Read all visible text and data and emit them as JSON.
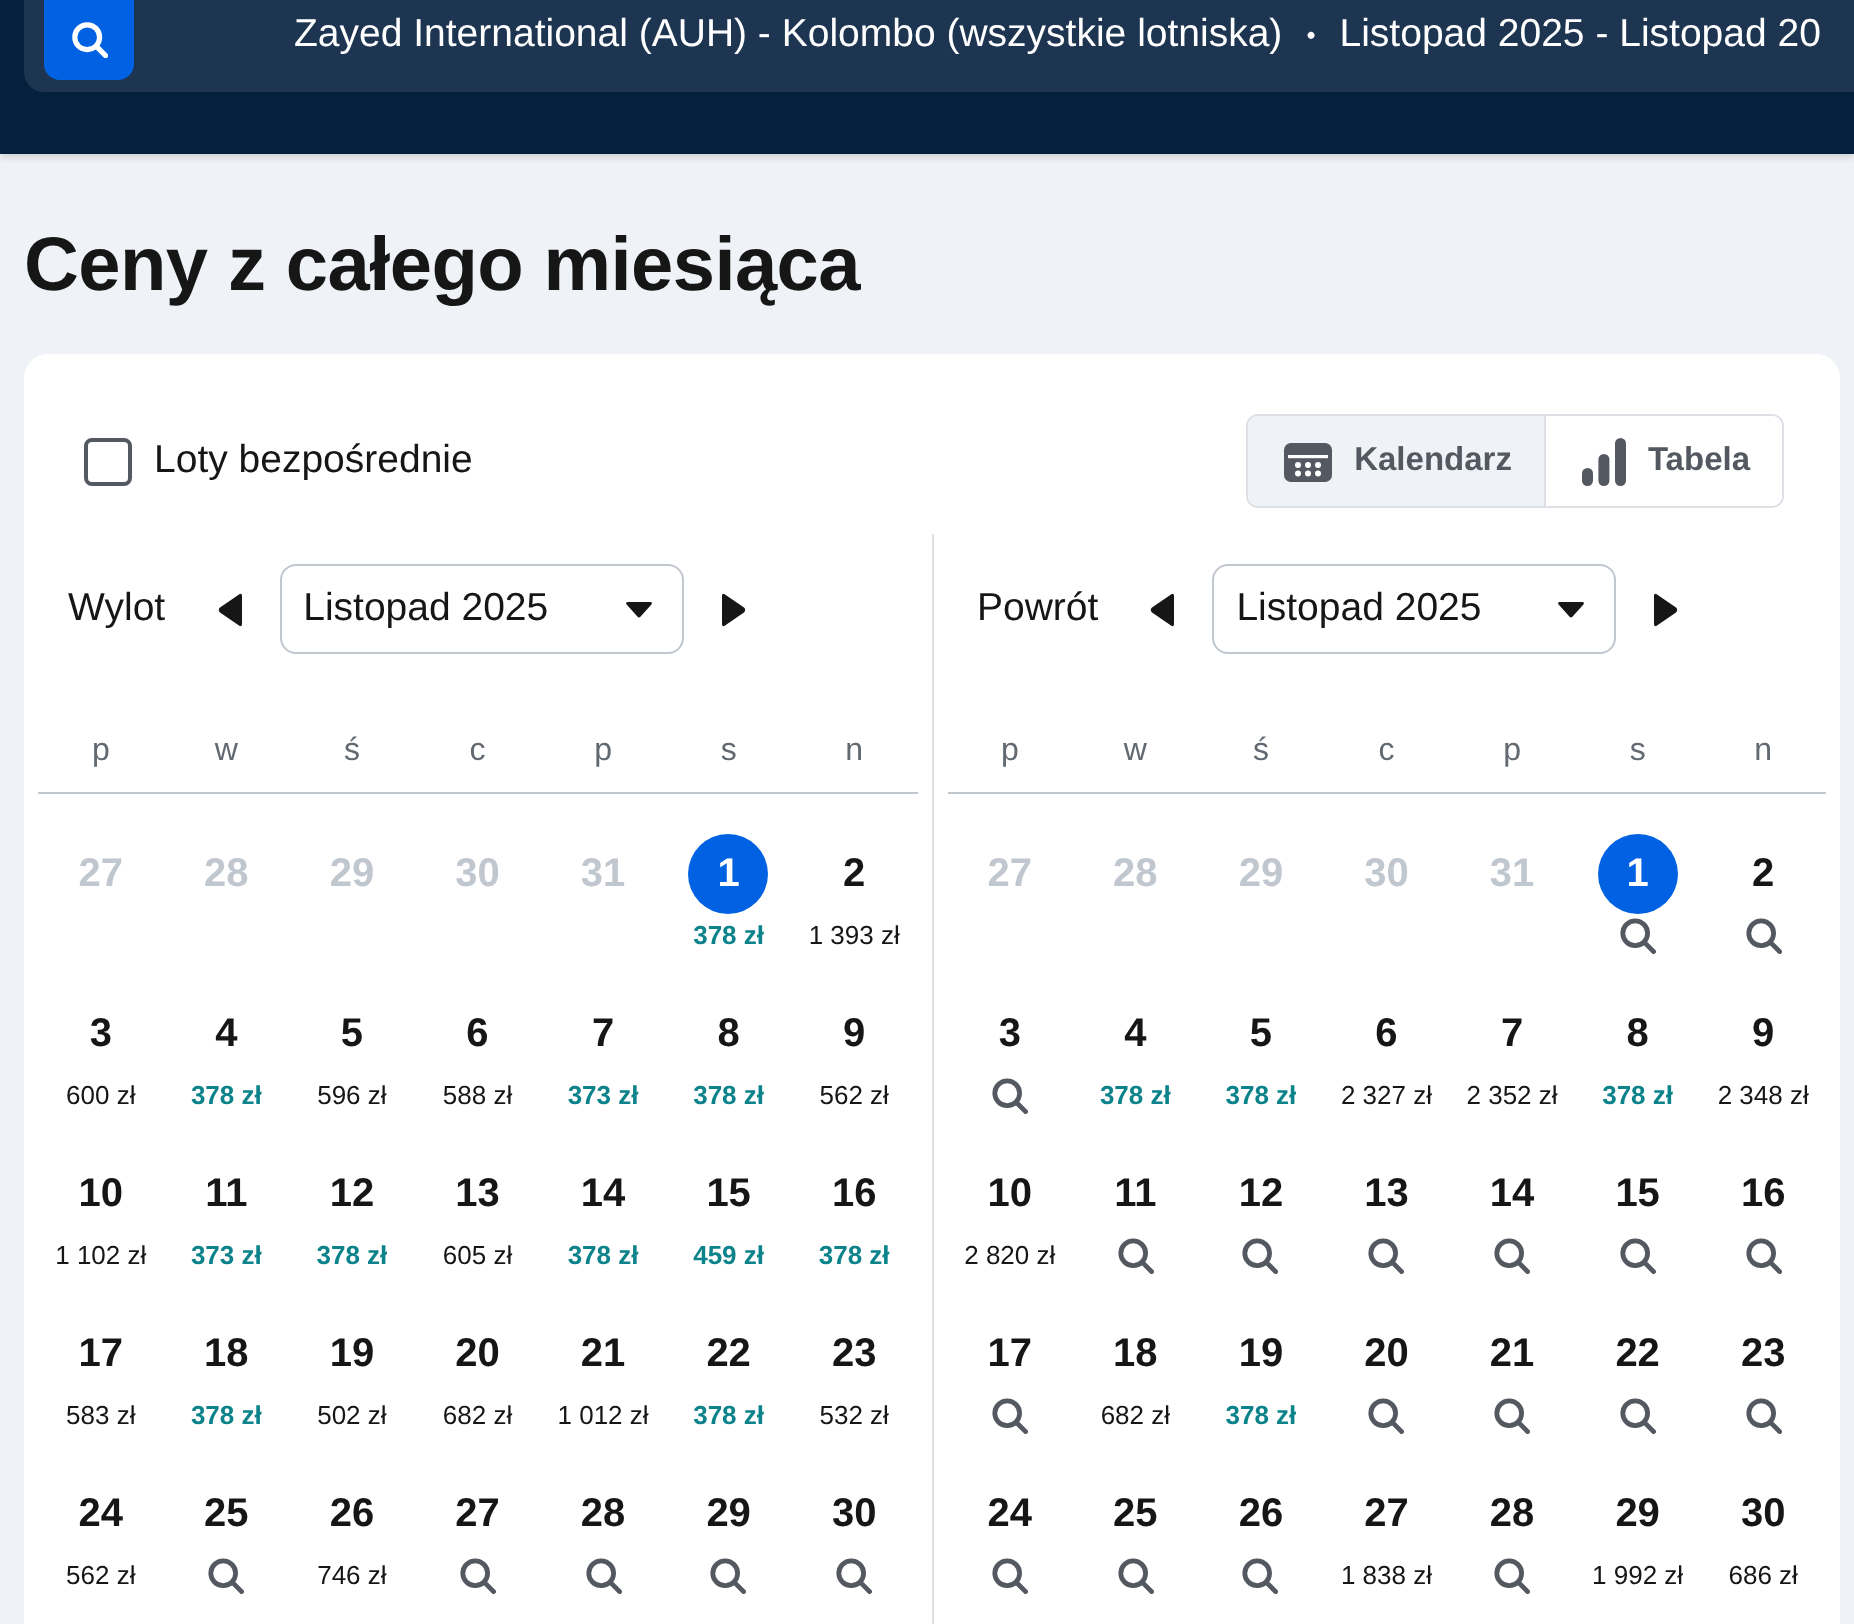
{
  "header": {
    "route": "Zayed International (AUH) - Kolombo (wszystkie lotniska)",
    "separator": "•",
    "dates": "Listopad 2025 - Listopad 20"
  },
  "title": "Ceny z całego miesiąca",
  "direct_filter": {
    "label": "Loty bezpośrednie",
    "checked": false
  },
  "view_tabs": [
    {
      "label": "Kalendarz",
      "kind": "calendar",
      "selected": true
    },
    {
      "label": "Tabela",
      "kind": "chart",
      "selected": false
    }
  ],
  "calendars": [
    {
      "label": "Wylot",
      "month": "Listopad 2025",
      "weekdays": [
        "p",
        "w",
        "ś",
        "c",
        "p",
        "s",
        "n"
      ],
      "days": [
        {
          "day": "27",
          "kind": "empty",
          "outside": true,
          "selected": false
        },
        {
          "day": "28",
          "kind": "empty",
          "outside": true,
          "selected": false
        },
        {
          "day": "29",
          "kind": "empty",
          "outside": true,
          "selected": false
        },
        {
          "day": "30",
          "kind": "empty",
          "outside": true,
          "selected": false
        },
        {
          "day": "31",
          "kind": "empty",
          "outside": true,
          "selected": false
        },
        {
          "day": "1",
          "kind": "price",
          "price": "378 zł",
          "highlighted": true,
          "outside": false,
          "selected": true
        },
        {
          "day": "2",
          "kind": "price",
          "price": "1 393 zł",
          "highlighted": false,
          "outside": false,
          "selected": false
        },
        {
          "day": "3",
          "kind": "price",
          "price": "600 zł",
          "highlighted": false,
          "outside": false,
          "selected": false
        },
        {
          "day": "4",
          "kind": "price",
          "price": "378 zł",
          "highlighted": true,
          "outside": false,
          "selected": false
        },
        {
          "day": "5",
          "kind": "price",
          "price": "596 zł",
          "highlighted": false,
          "outside": false,
          "selected": false
        },
        {
          "day": "6",
          "kind": "price",
          "price": "588 zł",
          "highlighted": false,
          "outside": false,
          "selected": false
        },
        {
          "day": "7",
          "kind": "price",
          "price": "373 zł",
          "highlighted": true,
          "outside": false,
          "selected": false
        },
        {
          "day": "8",
          "kind": "price",
          "price": "378 zł",
          "highlighted": true,
          "outside": false,
          "selected": false
        },
        {
          "day": "9",
          "kind": "price",
          "price": "562 zł",
          "highlighted": false,
          "outside": false,
          "selected": false
        },
        {
          "day": "10",
          "kind": "price",
          "price": "1 102 zł",
          "highlighted": false,
          "outside": false,
          "selected": false
        },
        {
          "day": "11",
          "kind": "price",
          "price": "373 zł",
          "highlighted": true,
          "outside": false,
          "selected": false
        },
        {
          "day": "12",
          "kind": "price",
          "price": "378 zł",
          "highlighted": true,
          "outside": false,
          "selected": false
        },
        {
          "day": "13",
          "kind": "price",
          "price": "605 zł",
          "highlighted": false,
          "outside": false,
          "selected": false
        },
        {
          "day": "14",
          "kind": "price",
          "price": "378 zł",
          "highlighted": true,
          "outside": false,
          "selected": false
        },
        {
          "day": "15",
          "kind": "price",
          "price": "459 zł",
          "highlighted": true,
          "outside": false,
          "selected": false
        },
        {
          "day": "16",
          "kind": "price",
          "price": "378 zł",
          "highlighted": true,
          "outside": false,
          "selected": false
        },
        {
          "day": "17",
          "kind": "price",
          "price": "583 zł",
          "highlighted": false,
          "outside": false,
          "selected": false
        },
        {
          "day": "18",
          "kind": "price",
          "price": "378 zł",
          "highlighted": true,
          "outside": false,
          "selected": false
        },
        {
          "day": "19",
          "kind": "price",
          "price": "502 zł",
          "highlighted": false,
          "outside": false,
          "selected": false
        },
        {
          "day": "20",
          "kind": "price",
          "price": "682 zł",
          "highlighted": false,
          "outside": false,
          "selected": false
        },
        {
          "day": "21",
          "kind": "price",
          "price": "1 012 zł",
          "highlighted": false,
          "outside": false,
          "selected": false
        },
        {
          "day": "22",
          "kind": "price",
          "price": "378 zł",
          "highlighted": true,
          "outside": false,
          "selected": false
        },
        {
          "day": "23",
          "kind": "price",
          "price": "532 zł",
          "highlighted": false,
          "outside": false,
          "selected": false
        },
        {
          "day": "24",
          "kind": "price",
          "price": "562 zł",
          "highlighted": false,
          "outside": false,
          "selected": false
        },
        {
          "day": "25",
          "kind": "search",
          "outside": false,
          "selected": false
        },
        {
          "day": "26",
          "kind": "price",
          "price": "746 zł",
          "highlighted": false,
          "outside": false,
          "selected": false
        },
        {
          "day": "27",
          "kind": "search",
          "outside": false,
          "selected": false
        },
        {
          "day": "28",
          "kind": "search",
          "outside": false,
          "selected": false
        },
        {
          "day": "29",
          "kind": "search",
          "outside": false,
          "selected": false
        },
        {
          "day": "30",
          "kind": "search",
          "outside": false,
          "selected": false
        }
      ]
    },
    {
      "label": "Powrót",
      "month": "Listopad 2025",
      "weekdays": [
        "p",
        "w",
        "ś",
        "c",
        "p",
        "s",
        "n"
      ],
      "days": [
        {
          "day": "27",
          "kind": "empty",
          "outside": true,
          "selected": false
        },
        {
          "day": "28",
          "kind": "empty",
          "outside": true,
          "selected": false
        },
        {
          "day": "29",
          "kind": "empty",
          "outside": true,
          "selected": false
        },
        {
          "day": "30",
          "kind": "empty",
          "outside": true,
          "selected": false
        },
        {
          "day": "31",
          "kind": "empty",
          "outside": true,
          "selected": false
        },
        {
          "day": "1",
          "kind": "search",
          "outside": false,
          "selected": true
        },
        {
          "day": "2",
          "kind": "search",
          "outside": false,
          "selected": false
        },
        {
          "day": "3",
          "kind": "search",
          "outside": false,
          "selected": false
        },
        {
          "day": "4",
          "kind": "price",
          "price": "378 zł",
          "highlighted": true,
          "outside": false,
          "selected": false
        },
        {
          "day": "5",
          "kind": "price",
          "price": "378 zł",
          "highlighted": true,
          "outside": false,
          "selected": false
        },
        {
          "day": "6",
          "kind": "price",
          "price": "2 327 zł",
          "highlighted": false,
          "outside": false,
          "selected": false
        },
        {
          "day": "7",
          "kind": "price",
          "price": "2 352 zł",
          "highlighted": false,
          "outside": false,
          "selected": false
        },
        {
          "day": "8",
          "kind": "price",
          "price": "378 zł",
          "highlighted": true,
          "outside": false,
          "selected": false
        },
        {
          "day": "9",
          "kind": "price",
          "price": "2 348 zł",
          "highlighted": false,
          "outside": false,
          "selected": false
        },
        {
          "day": "10",
          "kind": "price",
          "price": "2 820 zł",
          "highlighted": false,
          "outside": false,
          "selected": false
        },
        {
          "day": "11",
          "kind": "search",
          "outside": false,
          "selected": false
        },
        {
          "day": "12",
          "kind": "search",
          "outside": false,
          "selected": false
        },
        {
          "day": "13",
          "kind": "search",
          "outside": false,
          "selected": false
        },
        {
          "day": "14",
          "kind": "search",
          "outside": false,
          "selected": false
        },
        {
          "day": "15",
          "kind": "search",
          "outside": false,
          "selected": false
        },
        {
          "day": "16",
          "kind": "search",
          "outside": false,
          "selected": false
        },
        {
          "day": "17",
          "kind": "search",
          "outside": false,
          "selected": false
        },
        {
          "day": "18",
          "kind": "price",
          "price": "682 zł",
          "highlighted": false,
          "outside": false,
          "selected": false
        },
        {
          "day": "19",
          "kind": "price",
          "price": "378 zł",
          "highlighted": true,
          "outside": false,
          "selected": false
        },
        {
          "day": "20",
          "kind": "search",
          "outside": false,
          "selected": false
        },
        {
          "day": "21",
          "kind": "search",
          "outside": false,
          "selected": false
        },
        {
          "day": "22",
          "kind": "search",
          "outside": false,
          "selected": false
        },
        {
          "day": "23",
          "kind": "search",
          "outside": false,
          "selected": false
        },
        {
          "day": "24",
          "kind": "search",
          "outside": false,
          "selected": false
        },
        {
          "day": "25",
          "kind": "search",
          "outside": false,
          "selected": false
        },
        {
          "day": "26",
          "kind": "search",
          "outside": false,
          "selected": false
        },
        {
          "day": "27",
          "kind": "price",
          "price": "1 838 zł",
          "highlighted": false,
          "outside": false,
          "selected": false
        },
        {
          "day": "28",
          "kind": "search",
          "outside": false,
          "selected": false
        },
        {
          "day": "29",
          "kind": "price",
          "price": "1 992 zł",
          "highlighted": false,
          "outside": false,
          "selected": false
        },
        {
          "day": "30",
          "kind": "price",
          "price": "686 zł",
          "highlighted": false,
          "outside": false,
          "selected": false
        }
      ]
    }
  ]
}
